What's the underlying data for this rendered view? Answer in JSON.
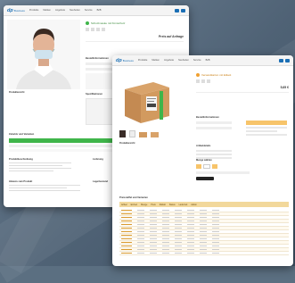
{
  "window_back": {
    "nav": {
      "logo": "dp",
      "logo_sub": "Business",
      "items": [
        "Produkte",
        "Marken",
        "Angebote",
        "Neuheiten",
        "Service",
        "B2B",
        "Kontakt",
        "Mein Konto"
      ]
    },
    "product_title": "Schutzmaske mit Kinnschutz",
    "price": "Preis auf Anfrage",
    "left_caption": "Produktansicht",
    "order_section_title": "Bestellinformationen",
    "specs_title": "Spezifikationen",
    "accessories_title": "Zubehör und Varianten",
    "desc_title": "Produktbeschreibung",
    "desc_title2": "Hinweis zum Produkt",
    "right_block_title": "Lieferung",
    "right_block_title2": "Lagerbestand"
  },
  "window_front": {
    "nav": {
      "logo": "dp",
      "logo_sub": "Business",
      "items": [
        "Produkte",
        "Marken",
        "Angebote",
        "Neuheiten",
        "Service",
        "B2B",
        "Kontakt",
        "Mein Konto"
      ]
    },
    "product_title": "Versandkarton mit Etikett",
    "price": "5,65 €",
    "order_section_title": "Bestellinformationen",
    "spec_title": "Artikeldetails",
    "qty_title": "Menge wählen",
    "table_title": "Preisstaffel und Varianten",
    "table_columns": [
      "Artikel",
      "Einheit",
      "Menge",
      "Preis",
      "Rabatt",
      "Status",
      "Lieferzeit",
      "Aktion"
    ],
    "table_rows": 13,
    "thumb_caption": "Produktansicht"
  },
  "colors": {
    "brand": "#1b6fb5",
    "accent_green": "#3fb54a",
    "table_header": "#f2d89b",
    "button_orange": "#f0a030"
  },
  "icons": [
    "person-photo",
    "box-photo",
    "cart-icon",
    "star-icon"
  ]
}
